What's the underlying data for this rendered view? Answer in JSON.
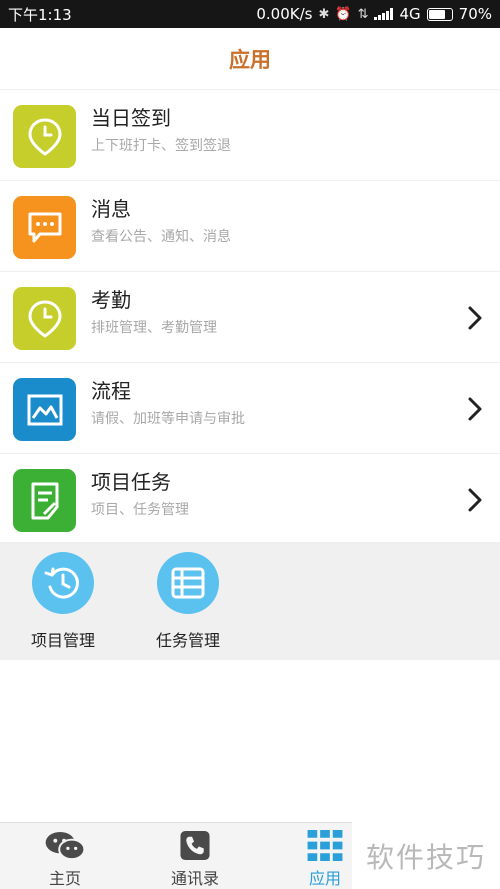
{
  "status_bar": {
    "time": "下午1:13",
    "speed": "0.00K/s",
    "network": "4G",
    "battery": "70%"
  },
  "header": {
    "title": "应用"
  },
  "apps": [
    {
      "title": "当日签到",
      "subtitle": "上下班打卡、签到签退",
      "icon": "location-clock-icon",
      "color": "#c5ce2b",
      "has_chevron": false
    },
    {
      "title": "消息",
      "subtitle": "查看公告、通知、消息",
      "icon": "chat-bubble-icon",
      "color": "#f6921e",
      "has_chevron": false
    },
    {
      "title": "考勤",
      "subtitle": "排班管理、考勤管理",
      "icon": "location-clock-icon",
      "color": "#c5ce2b",
      "has_chevron": true
    },
    {
      "title": "流程",
      "subtitle": "请假、加班等申请与审批",
      "icon": "picture-icon",
      "color": "#1a8ccc",
      "has_chevron": true
    },
    {
      "title": "项目任务",
      "subtitle": "项目、任务管理",
      "icon": "document-pen-icon",
      "color": "#3cb034",
      "has_chevron": true
    }
  ],
  "grid": [
    {
      "label": "项目管理",
      "icon": "history-clock-icon"
    },
    {
      "label": "任务管理",
      "icon": "list-icon"
    }
  ],
  "bottom_nav": [
    {
      "label": "主页",
      "icon": "wechat-icon",
      "active": false
    },
    {
      "label": "通讯录",
      "icon": "phone-icon",
      "active": false
    },
    {
      "label": "应用",
      "icon": "apps-grid-icon",
      "active": true
    }
  ],
  "watermark": "软件技巧",
  "colors": {
    "accent": "#c9702a",
    "active_nav": "#2a9fd8",
    "grid_circle": "#5bc1ef"
  }
}
